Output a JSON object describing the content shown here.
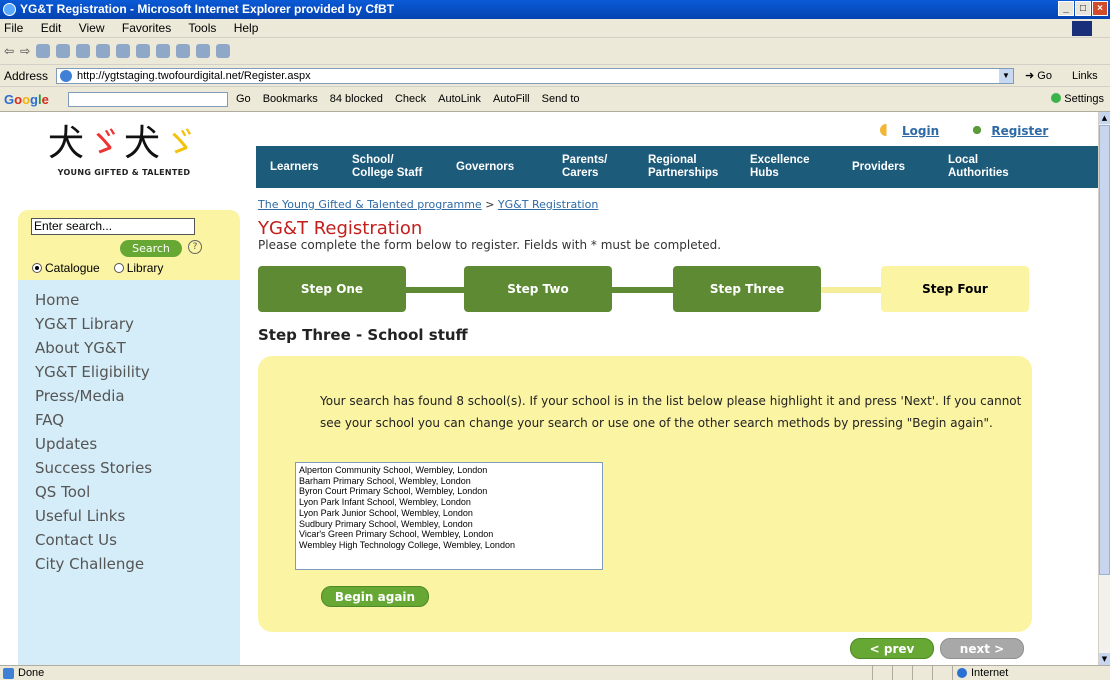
{
  "browser": {
    "title": "YG&T Registration - Microsoft Internet Explorer provided by CfBT",
    "menu": [
      "File",
      "Edit",
      "View",
      "Favorites",
      "Tools",
      "Help"
    ],
    "address_label": "Address",
    "url": "http://ygtstaging.twofourdigital.net/Register.aspx",
    "go_label": "Go",
    "links_label": "Links",
    "google_bar": {
      "logo": "Google",
      "items": [
        "Go",
        "Bookmarks",
        "84 blocked",
        "Check",
        "AutoLink",
        "AutoFill",
        "Send to"
      ],
      "settings": "Settings"
    },
    "status": "Done",
    "zone": "Internet"
  },
  "site": {
    "logo_text": "YOUNG GIFTED & TALENTED",
    "top_links": {
      "login": "Login",
      "register": "Register"
    },
    "nav": [
      {
        "line1": "Learners",
        "line2": ""
      },
      {
        "line1": "School/",
        "line2": "College Staff"
      },
      {
        "line1": "Governors",
        "line2": ""
      },
      {
        "line1": "Parents/",
        "line2": "Carers"
      },
      {
        "line1": "Regional",
        "line2": "Partnerships"
      },
      {
        "line1": "Excellence",
        "line2": "Hubs"
      },
      {
        "line1": "Providers",
        "line2": ""
      },
      {
        "line1": "Local",
        "line2": "Authorities"
      }
    ],
    "sidebar": {
      "search_placeholder": "Enter search...",
      "search_button": "Search",
      "help_glyph": "?",
      "radio_catalogue": "Catalogue",
      "radio_library": "Library",
      "items": [
        "Home",
        "YG&T Library",
        "About YG&T",
        "YG&T Eligibility",
        "Press/Media",
        "FAQ",
        "Updates",
        "Success Stories",
        "QS Tool",
        "Useful Links",
        "Contact Us",
        "City Challenge"
      ]
    },
    "breadcrumb": {
      "root": "The Young Gifted & Talented programme",
      "sep": ">",
      "current": "YG&T Registration"
    },
    "page_title": "YG&T Registration",
    "intro": "Please complete the form below to register. Fields with * must be completed.",
    "steps": [
      "Step One",
      "Step Two",
      "Step Three",
      "Step Four"
    ],
    "section_title": "Step Three - School stuff",
    "message": "Your search has found 8 school(s). If your school is in the list below please highlight it and press 'Next'. If you cannot see your school you can change your search or use one of the other search methods by pressing \"Begin again\".",
    "schools": [
      "Alperton Community School, Wembley, London",
      "Barham Primary School, Wembley, London",
      "Byron Court Primary School, Wembley, London",
      "Lyon Park Infant School, Wembley, London",
      "Lyon Park Junior School, Wembley, London",
      "Sudbury Primary School, Wembley, London",
      "Vicar's Green Primary School, Wembley, London",
      "Wembley High Technology College, Wembley, London"
    ],
    "begin_again": "Begin again",
    "prev": "< prev",
    "next": "next >"
  },
  "colors": {
    "nav_bg": "#1d5b7a",
    "step_green": "#5d8a32",
    "panel_yellow": "#fbf4a3",
    "title_red": "#c2201c",
    "sidenav_blue": "#d5edf8"
  }
}
